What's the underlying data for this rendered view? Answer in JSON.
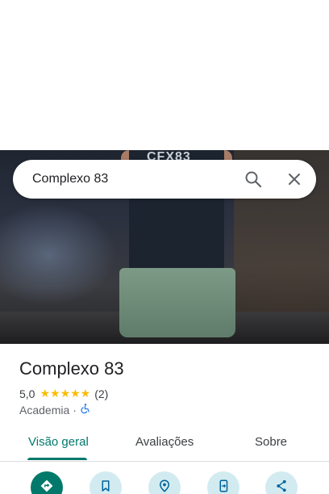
{
  "search": {
    "query": "Complexo 83"
  },
  "hero": {
    "shirt_print": "CFX83"
  },
  "place": {
    "name": "Complexo 83",
    "rating": "5,0",
    "stars": "★★★★★",
    "review_count": "(2)",
    "category": "Academia",
    "separator": "·"
  },
  "tabs": [
    {
      "label": "Visão geral",
      "active": true
    },
    {
      "label": "Avaliações",
      "active": false
    },
    {
      "label": "Sobre",
      "active": false
    }
  ],
  "actions": [
    {
      "icon": "directions-icon"
    },
    {
      "icon": "bookmark-icon"
    },
    {
      "icon": "nearby-icon"
    },
    {
      "icon": "send-to-phone-icon"
    },
    {
      "icon": "share-icon"
    }
  ],
  "colors": {
    "accent": "#00796b",
    "star": "#fbbc04",
    "action_bg": "#d2ebf0",
    "accessibility": "#1a73e8"
  }
}
